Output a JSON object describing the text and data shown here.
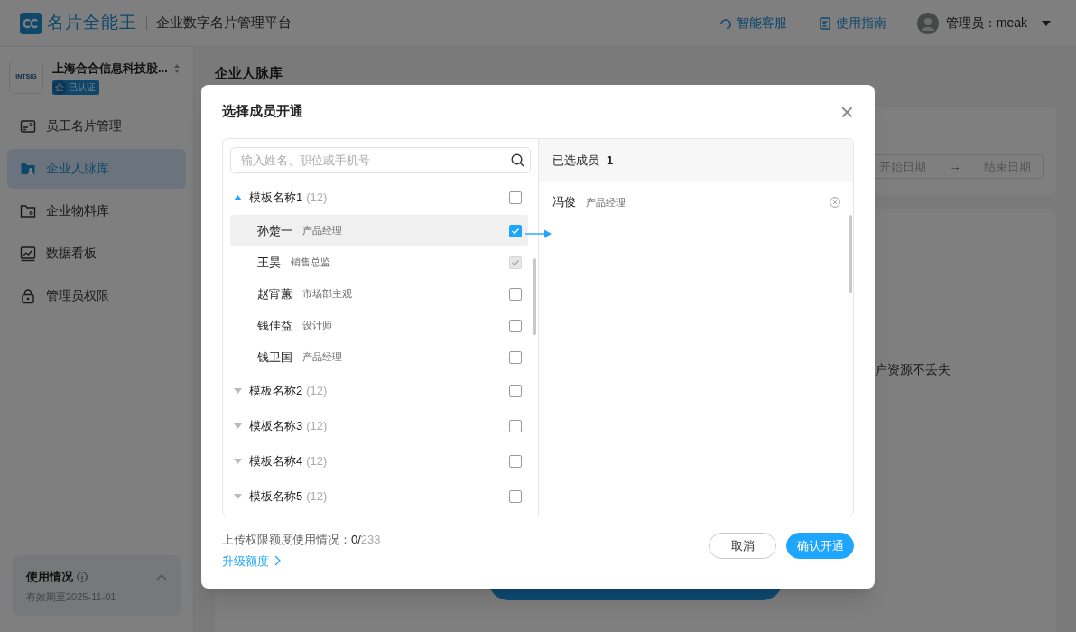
{
  "header": {
    "brand": "名片全能王",
    "subtitle": "企业数字名片管理平台",
    "links": [
      {
        "kind": "support",
        "label": "智能客服"
      },
      {
        "kind": "guide",
        "label": "使用指南"
      }
    ],
    "user": "管理员：meak"
  },
  "sidebar": {
    "company": "上海合合信息科技股...",
    "company_logo": "INTSIG",
    "badge_mark": "企",
    "badge": "已认证",
    "items": [
      {
        "kind": "card",
        "label": "员工名片管理",
        "selected": false
      },
      {
        "kind": "contacts",
        "label": "企业人脉库",
        "selected": true
      },
      {
        "kind": "folder",
        "label": "企业物料库",
        "selected": false
      },
      {
        "kind": "chart",
        "label": "数据看板",
        "selected": false
      },
      {
        "kind": "lock",
        "label": "管理员权限",
        "selected": false
      }
    ],
    "usage": {
      "title": "使用情况",
      "expiry": "有效期至2025-11-01"
    }
  },
  "main": {
    "title": "企业人脉库",
    "date_start": "开始日期",
    "date_arrow": "→",
    "date_end": "结束日期",
    "note": "户资源不丢失"
  },
  "dialog": {
    "title": "选择成员开通",
    "close": "×",
    "search": {
      "placeholder": "输入姓名、职位或手机号"
    },
    "groups": [
      {
        "name": "模板名称1",
        "count": "(12)",
        "expanded": true,
        "checked": false,
        "children": [
          {
            "name": "孙楚一",
            "title": "产品经理",
            "selected": true,
            "checked": true,
            "disabled": false
          },
          {
            "name": "王昊",
            "title": "销售总监",
            "selected": false,
            "checked": true,
            "disabled": true
          },
          {
            "name": "赵宵蕙",
            "title": "市场部主观",
            "selected": false,
            "checked": false,
            "disabled": false
          },
          {
            "name": "钱佳益",
            "title": "设计师",
            "selected": false,
            "checked": false,
            "disabled": false
          },
          {
            "name": "钱卫国",
            "title": "产品经理",
            "selected": false,
            "checked": false,
            "disabled": false
          }
        ]
      },
      {
        "name": "模板名称2",
        "count": "(12)",
        "expanded": false,
        "checked": false
      },
      {
        "name": "模板名称3",
        "count": "(12)",
        "expanded": false,
        "checked": false
      },
      {
        "name": "模板名称4",
        "count": "(12)",
        "expanded": false,
        "checked": false
      },
      {
        "name": "模板名称5",
        "count": "(12)",
        "expanded": false,
        "checked": false
      }
    ],
    "selected_label": "已选成员",
    "selected_count": "1",
    "selected_members": [
      {
        "name": "冯俊",
        "title": "产品经理"
      }
    ],
    "quota": {
      "label": "上传权限额度使用情况：",
      "used": "0/",
      "limit": "233"
    },
    "upgrade": "升级额度",
    "buttons": [
      {
        "kind": "secondary",
        "label": "取消"
      },
      {
        "kind": "primary",
        "label": "确认开通"
      }
    ]
  }
}
